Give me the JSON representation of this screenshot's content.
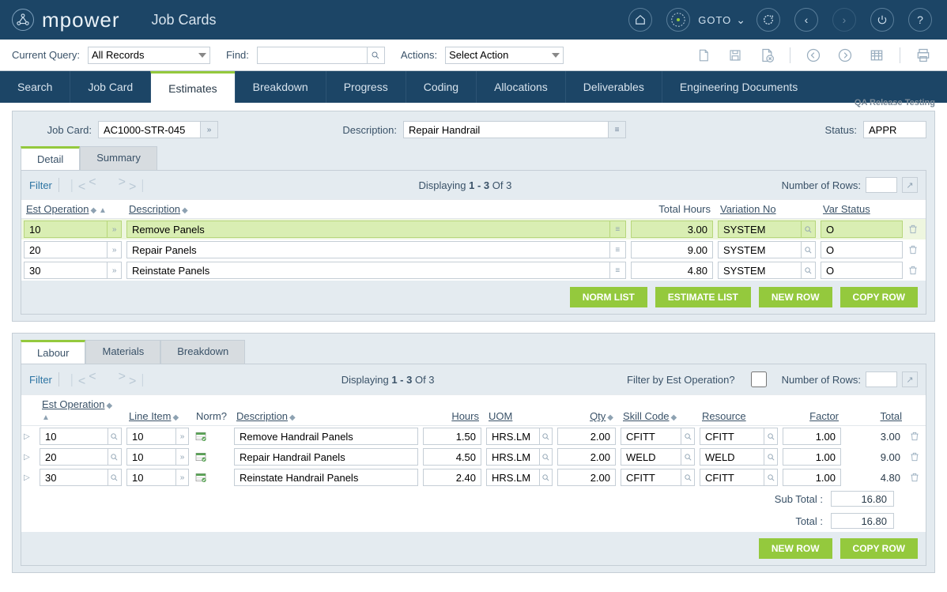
{
  "app": {
    "logo_text": "mpower",
    "page_title": "Job Cards"
  },
  "header": {
    "goto": "GOTO"
  },
  "subheader": {
    "current_query_label": "Current Query:",
    "current_query_value": "All Records",
    "find_label": "Find:",
    "actions_label": "Actions:",
    "actions_value": "Select Action",
    "qa_text": "QA Release Testing"
  },
  "tabs": [
    "Search",
    "Job Card",
    "Estimates",
    "Breakdown",
    "Progress",
    "Coding",
    "Allocations",
    "Deliverables",
    "Engineering Documents"
  ],
  "active_tab": "Estimates",
  "info": {
    "job_card_label": "Job Card:",
    "job_card_value": "AC1000-STR-045",
    "desc_label": "Description:",
    "desc_value": "Repair Handrail",
    "status_label": "Status:",
    "status_value": "APPR"
  },
  "ops_tabs": [
    "Detail",
    "Summary"
  ],
  "ops_active_tab": "Detail",
  "ops_tool": {
    "filter": "Filter",
    "displaying_pre": "Displaying ",
    "displaying_bold": "1 - 3",
    "displaying_post": " Of 3",
    "num_rows_label": "Number of Rows:"
  },
  "ops_columns": {
    "op": "Est Operation",
    "desc": "Description",
    "hours": "Total Hours",
    "var_no": "Variation No",
    "var_status": "Var Status"
  },
  "ops_rows": [
    {
      "op": "10",
      "desc": "Remove Panels",
      "hours": "3.00",
      "var_no": "SYSTEM",
      "var_status": "O",
      "hl": true
    },
    {
      "op": "20",
      "desc": "Repair Panels",
      "hours": "9.00",
      "var_no": "SYSTEM",
      "var_status": "O",
      "hl": false
    },
    {
      "op": "30",
      "desc": "Reinstate Panels",
      "hours": "4.80",
      "var_no": "SYSTEM",
      "var_status": "O",
      "hl": false
    }
  ],
  "ops_buttons": [
    "NORM LIST",
    "ESTIMATE LIST",
    "NEW ROW",
    "COPY ROW"
  ],
  "labour_tabs": [
    "Labour",
    "Materials",
    "Breakdown"
  ],
  "labour_active_tab": "Labour",
  "labour_tool": {
    "filter": "Filter",
    "displaying_pre": "Displaying ",
    "displaying_bold": "1 - 3",
    "displaying_post": " Of 3",
    "filter_by_op": "Filter by Est Operation?",
    "num_rows_label": "Number of Rows:"
  },
  "labour_columns": {
    "op": "Est Operation",
    "line": "Line Item",
    "norm": "Norm?",
    "desc": "Description",
    "hours": "Hours",
    "uom": "UOM",
    "qty": "Qty",
    "skill": "Skill Code",
    "resource": "Resource",
    "factor": "Factor",
    "total": "Total"
  },
  "labour_rows": [
    {
      "op": "10",
      "line": "10",
      "desc": "Remove Handrail Panels",
      "hours": "1.50",
      "uom": "HRS.LM",
      "qty": "2.00",
      "skill": "CFITT",
      "resource": "CFITT",
      "factor": "1.00",
      "total": "3.00"
    },
    {
      "op": "20",
      "line": "10",
      "desc": "Repair Handrail Panels",
      "hours": "4.50",
      "uom": "HRS.LM",
      "qty": "2.00",
      "skill": "WELD",
      "resource": "WELD",
      "factor": "1.00",
      "total": "9.00"
    },
    {
      "op": "30",
      "line": "10",
      "desc": "Reinstate Handrail Panels",
      "hours": "2.40",
      "uom": "HRS.LM",
      "qty": "2.00",
      "skill": "CFITT",
      "resource": "CFITT",
      "factor": "1.00",
      "total": "4.80"
    }
  ],
  "totals": {
    "sub_label": "Sub Total :",
    "sub_val": "16.80",
    "total_label": "Total :",
    "total_val": "16.80"
  },
  "labour_buttons": [
    "NEW ROW",
    "COPY ROW"
  ]
}
